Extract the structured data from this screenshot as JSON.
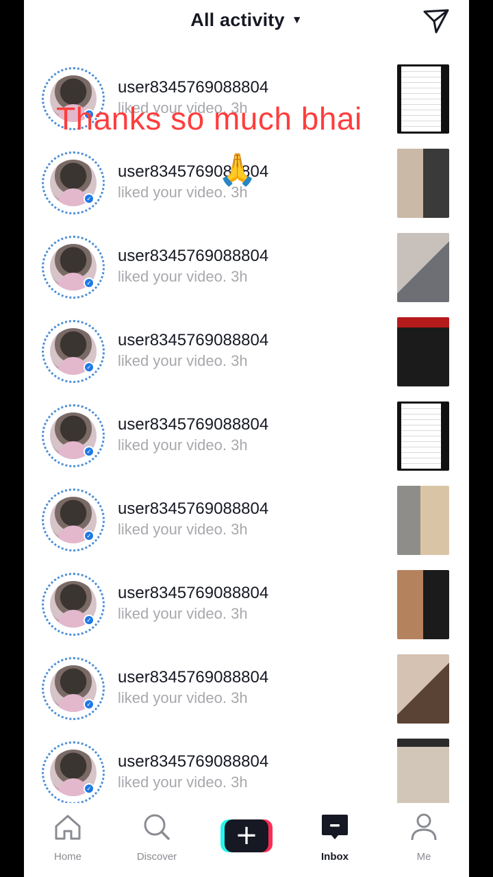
{
  "header": {
    "title": "All activity",
    "send_icon": "send-icon"
  },
  "overlay": {
    "caption": "Thanks so much bhai",
    "emoji": "🙏"
  },
  "activities": [
    {
      "username": "user8345769088804",
      "text": "liked your video. 3h",
      "thumb": "t-list"
    },
    {
      "username": "user8345769088804",
      "text": "liked your video. 3h",
      "thumb": "t-face1"
    },
    {
      "username": "user8345769088804",
      "text": "liked your video. 3h",
      "thumb": "t-face2"
    },
    {
      "username": "user8345769088804",
      "text": "liked your video. 3h",
      "thumb": "t-face3"
    },
    {
      "username": "user8345769088804",
      "text": "liked your video. 3h",
      "thumb": "t-list"
    },
    {
      "username": "user8345769088804",
      "text": "liked your video. 3h",
      "thumb": "t-face4"
    },
    {
      "username": "user8345769088804",
      "text": "liked your video. 3h",
      "thumb": "t-face5"
    },
    {
      "username": "user8345769088804",
      "text": "liked your video. 3h",
      "thumb": "t-face6"
    },
    {
      "username": "user8345769088804",
      "text": "liked your video. 3h",
      "thumb": "t-face7"
    }
  ],
  "nav": {
    "home": "Home",
    "discover": "Discover",
    "inbox": "Inbox",
    "me": "Me",
    "create_symbol": "+",
    "active_tab": "Inbox"
  },
  "colors": {
    "overlay_text": "#ff3d3d",
    "badge": "#1e78e6",
    "create_cyan": "#25f4ee",
    "create_red": "#fe2c55",
    "text_primary": "#161823",
    "text_secondary": "#a7a8ad"
  }
}
